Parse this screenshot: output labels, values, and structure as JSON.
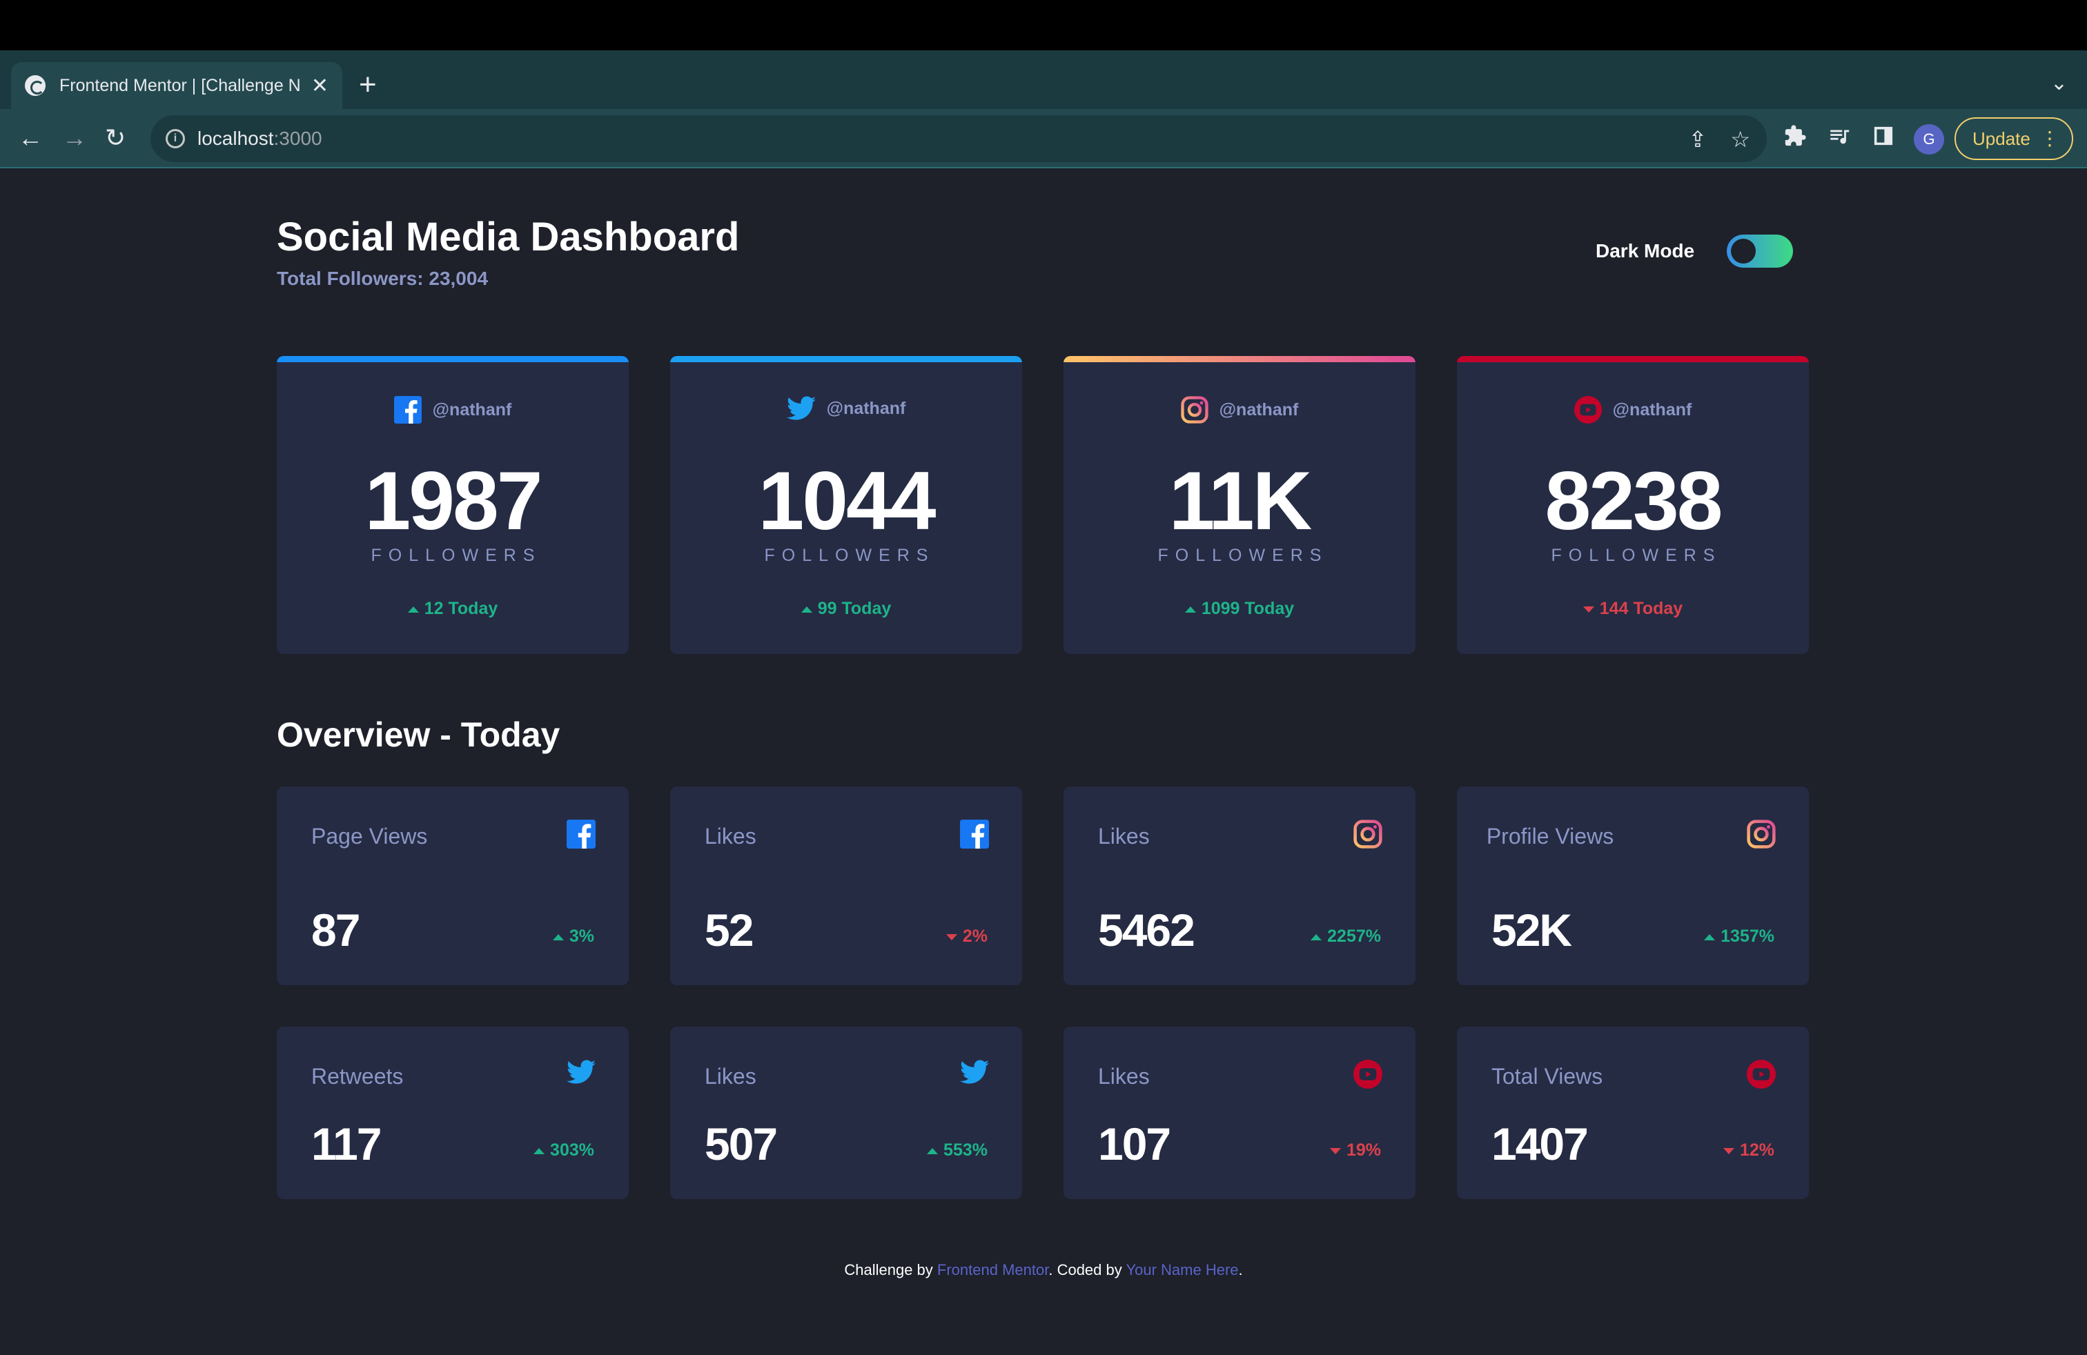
{
  "browser": {
    "tab_title": "Frontend Mentor | [Challenge N",
    "tab_close": "✕",
    "new_tab": "+",
    "url_host": "localhost",
    "url_port": ":3000",
    "avatar_letter": "G",
    "update_label": "Update"
  },
  "header": {
    "title": "Social Media Dashboard",
    "total_followers": "Total Followers: 23,004",
    "mode_label": "Dark Mode"
  },
  "colors": {
    "facebook": "#1877f2",
    "twitter": "#1da1f2",
    "youtube": "#c4032b",
    "up": "#1db489",
    "down": "#dc414c",
    "background": "#1e202a",
    "card": "#252b43"
  },
  "follower_cards": [
    {
      "network": "facebook",
      "icon": "facebook-icon",
      "handle": "@nathanf",
      "count": "1987",
      "unit": "FOLLOWERS",
      "today": "12 Today",
      "trend": "up"
    },
    {
      "network": "twitter",
      "icon": "twitter-icon",
      "handle": "@nathanf",
      "count": "1044",
      "unit": "FOLLOWERS",
      "today": "99 Today",
      "trend": "up"
    },
    {
      "network": "instagram",
      "icon": "instagram-icon",
      "handle": "@nathanf",
      "count": "11K",
      "unit": "FOLLOWERS",
      "today": "1099 Today",
      "trend": "up"
    },
    {
      "network": "youtube",
      "icon": "youtube-icon",
      "handle": "@nathanf",
      "count": "8238",
      "unit": "FOLLOWERS",
      "today": "144 Today",
      "trend": "down"
    }
  ],
  "overview": {
    "title": "Overview - Today",
    "cards": [
      {
        "label": "Page Views",
        "icon": "facebook-icon",
        "value": "87",
        "change": "3%",
        "trend": "up"
      },
      {
        "label": "Likes",
        "icon": "facebook-icon",
        "value": "52",
        "change": "2%",
        "trend": "down"
      },
      {
        "label": "Likes",
        "icon": "instagram-icon",
        "value": "5462",
        "change": "2257%",
        "trend": "up"
      },
      {
        "label": "Profile Views",
        "icon": "instagram-icon",
        "value": "52K",
        "change": "1357%",
        "trend": "up"
      },
      {
        "label": "Retweets",
        "icon": "twitter-icon",
        "value": "117",
        "change": "303%",
        "trend": "up"
      },
      {
        "label": "Likes",
        "icon": "twitter-icon",
        "value": "507",
        "change": "553%",
        "trend": "up"
      },
      {
        "label": "Likes",
        "icon": "youtube-icon",
        "value": "107",
        "change": "19%",
        "trend": "down"
      },
      {
        "label": "Total Views",
        "icon": "youtube-icon",
        "value": "1407",
        "change": "12%",
        "trend": "down"
      }
    ]
  },
  "footer": {
    "prefix": "Challenge by ",
    "link1": "Frontend Mentor",
    "middle": ". Coded by ",
    "link2": "Your Name Here",
    "suffix": "."
  }
}
